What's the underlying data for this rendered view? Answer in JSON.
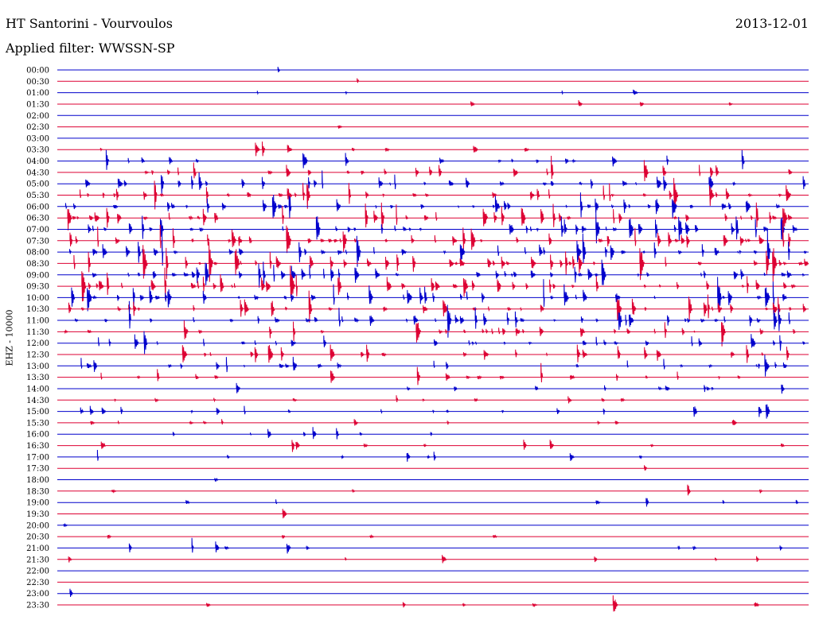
{
  "header": {
    "station": "HT Santorini - Vourvoulos",
    "filter": "Applied filter: WWSSN-SP",
    "date": "2013-12-01"
  },
  "chart_data": {
    "type": "line",
    "title": "HT Santorini - Vourvoulos",
    "subtitle": "Applied filter: WWSSN-SP",
    "ylabel": "EHZ - 10000",
    "row_labels": [
      "00:00",
      "00:30",
      "01:00",
      "01:30",
      "02:00",
      "02:30",
      "03:00",
      "03:30",
      "04:00",
      "04:30",
      "05:00",
      "05:30",
      "06:00",
      "06:30",
      "07:00",
      "07:30",
      "08:00",
      "08:30",
      "09:00",
      "09:30",
      "10:00",
      "10:30",
      "11:00",
      "11:30",
      "12:00",
      "12:30",
      "13:00",
      "13:30",
      "14:00",
      "14:30",
      "15:00",
      "15:30",
      "16:00",
      "16:30",
      "17:00",
      "17:30",
      "18:00",
      "18:30",
      "19:00",
      "19:30",
      "20:00",
      "20:30",
      "21:00",
      "21:30",
      "22:00",
      "22:30",
      "23:00",
      "23:30"
    ],
    "trace_colors": [
      "#0000cc",
      "#dd0033"
    ],
    "activity": [
      0,
      0,
      0.05,
      0.05,
      0,
      0,
      0,
      0.15,
      0.35,
      0.45,
      0.6,
      0.8,
      0.9,
      0.95,
      1.0,
      1.0,
      1.0,
      1.0,
      1.0,
      1.0,
      0.95,
      0.9,
      0.8,
      0.6,
      0.55,
      0.45,
      0.45,
      0.35,
      0.2,
      0.2,
      0.3,
      0.2,
      0.15,
      0.15,
      0.15,
      0,
      0,
      0.05,
      0.1,
      0,
      0,
      0.05,
      0.15,
      0.1,
      0,
      0,
      0,
      0.1
    ],
    "grid": false
  }
}
